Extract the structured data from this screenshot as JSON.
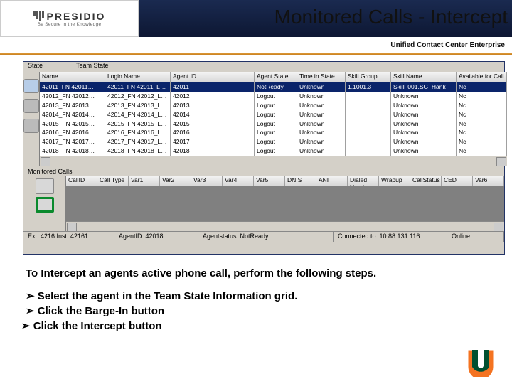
{
  "logo": {
    "name": "PRESIDIO",
    "tagline": "Be Secure in the Knowledge"
  },
  "title": "Monitored Calls - Intercept",
  "subtitle": "Unified Contact Center Enterprise",
  "teamGrid": {
    "labels": {
      "state": "State",
      "team": "Team State"
    },
    "cols": {
      "name": "Name",
      "login": "Login Name",
      "aid": "Agent ID",
      "empty": "",
      "astate": "Agent State",
      "tis": "Time in State",
      "sg": "Skill Group",
      "sn": "Skill Name",
      "avail": "Available for Call"
    },
    "rows": [
      {
        "name": "42011_FN  42011…",
        "login": "42011_FN 42011_L…",
        "aid": "42011",
        "empty": "",
        "astate": "NotReady",
        "tis": "Unknown",
        "sg": "1.1001.3",
        "sn": "Skill_001.SG_Hank",
        "avail": "Nc"
      },
      {
        "name": "42012_FN  42012…",
        "login": "42012_FN 42012_L…",
        "aid": "42012",
        "empty": "",
        "astate": "Logout",
        "tis": "Unknown",
        "sg": "",
        "sn": "Unknown",
        "avail": "Nc"
      },
      {
        "name": "42013_FN  42013…",
        "login": "42013_FN 42013_L…",
        "aid": "42013",
        "empty": "",
        "astate": "Logout",
        "tis": "Unknown",
        "sg": "",
        "sn": "Unknown",
        "avail": "Nc"
      },
      {
        "name": "42014_FN  42014…",
        "login": "42014_FN 42014_L…",
        "aid": "42014",
        "empty": "",
        "astate": "Logout",
        "tis": "Unknown",
        "sg": "",
        "sn": "Unknown",
        "avail": "Nc"
      },
      {
        "name": "42015_FN  42015…",
        "login": "42015_FN 42015_L…",
        "aid": "42015",
        "empty": "",
        "astate": "Logout",
        "tis": "Unknown",
        "sg": "",
        "sn": "Unknown",
        "avail": "Nc"
      },
      {
        "name": "42016_FN  42016…",
        "login": "42016_FN 42016_L…",
        "aid": "42016",
        "empty": "",
        "astate": "Logout",
        "tis": "Unknown",
        "sg": "",
        "sn": "Unknown",
        "avail": "Nc"
      },
      {
        "name": "42017_FN  42017…",
        "login": "42017_FN 42017_L…",
        "aid": "42017",
        "empty": "",
        "astate": "Logout",
        "tis": "Unknown",
        "sg": "",
        "sn": "Unknown",
        "avail": "Nc"
      },
      {
        "name": "42018_FN  42018…",
        "login": "42018_FN 42018_L…",
        "aid": "42018",
        "empty": "",
        "astate": "Logout",
        "tis": "Unknown",
        "sg": "",
        "sn": "Unknown",
        "avail": "Nc"
      }
    ]
  },
  "monitored": {
    "label": "Monitored Calls",
    "cols": [
      "CallID",
      "Call Type",
      "Var1",
      "Var2",
      "Var3",
      "Var4",
      "Var5",
      "DNIS",
      "ANI",
      "Dialed Number",
      "Wrapup",
      "CallStatus",
      "CED",
      "Var6"
    ]
  },
  "statusbar": {
    "ext": "Ext: 4216   Inst: 42161",
    "agent": "AgentID: 42018",
    "status": "Agentstatus: NotReady",
    "conn": "Connected to: 10.88.131.116",
    "online": "Online"
  },
  "instructions": {
    "lead": "To Intercept an agents active phone call, perform the following steps.",
    "steps": [
      "Select the agent in the Team State Information grid.",
      "Click the Barge-In button",
      "Click the Intercept button"
    ]
  }
}
